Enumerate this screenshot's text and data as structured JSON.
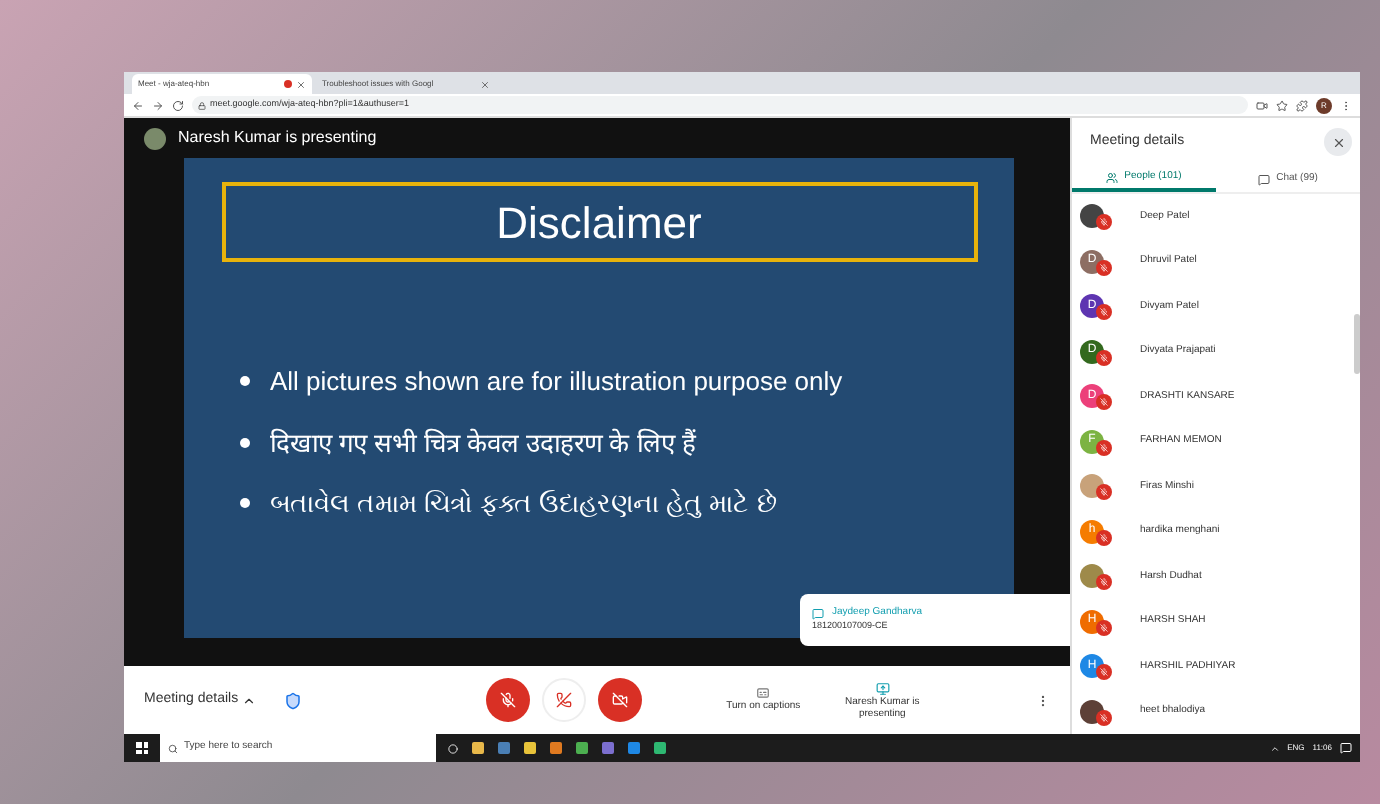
{
  "browser": {
    "tabs": [
      {
        "title": "Meet - wja-ateq-hbn",
        "selected": true,
        "recording": true
      },
      {
        "title": "Troubleshoot issues with Googl",
        "selected": false,
        "recording": false
      }
    ],
    "url": "meet.google.com/wja-ateq-hbn?pli=1&authuser=1",
    "profile_initial": "R"
  },
  "stage": {
    "presenter_label": "Naresh Kumar is presenting",
    "slide": {
      "title": "Disclaimer",
      "bullets": [
        "All pictures shown are for illustration purpose only",
        "दिखाए गए सभी चित्र केवल उदाहरण के लिए हैं",
        "બતાવેલ તમામ ચિત્રો ફક્ત ઉદાહરણના હેતુ માટે છે"
      ]
    },
    "toast": {
      "name": "Jaydeep Gandharva",
      "text": "181200107009-CE"
    }
  },
  "bottom_bar": {
    "meeting_details": "Meeting details",
    "mic_muted": true,
    "camera_off": true,
    "captions": "Turn on captions",
    "presenting": "Naresh Kumar is presenting"
  },
  "panel": {
    "title": "Meeting details",
    "tabs": [
      {
        "label": "People (101)",
        "selected": true
      },
      {
        "label": "Chat (99)",
        "selected": false
      }
    ],
    "participants": [
      {
        "name": "Deep Patel",
        "kind": "photo",
        "color": "#444444"
      },
      {
        "name": "Dhruvil Patel",
        "kind": "letter",
        "initial": "D",
        "color": "#8d6e63"
      },
      {
        "name": "Divyam Patel",
        "kind": "letter",
        "initial": "D",
        "color": "#5e35b1"
      },
      {
        "name": "Divyata Prajapati",
        "kind": "letter",
        "initial": "D",
        "color": "#33691e"
      },
      {
        "name": "DRASHTI KANSARE",
        "kind": "letter",
        "initial": "D",
        "color": "#ec407a"
      },
      {
        "name": "FARHAN MEMON",
        "kind": "letter",
        "initial": "F",
        "color": "#7cb342"
      },
      {
        "name": "Firas Minshi",
        "kind": "photo",
        "color": "#c8a27a"
      },
      {
        "name": "hardika menghani",
        "kind": "letter",
        "initial": "h",
        "color": "#f57c00"
      },
      {
        "name": "Harsh Dudhat",
        "kind": "photo",
        "color": "#9e8a4a"
      },
      {
        "name": "HARSH SHAH",
        "kind": "letter",
        "initial": "H",
        "color": "#ef6c00"
      },
      {
        "name": "HARSHIL PADHIYAR",
        "kind": "letter",
        "initial": "H",
        "color": "#1e88e5"
      },
      {
        "name": "heet bhalodiya",
        "kind": "photo",
        "color": "#5d4037"
      }
    ]
  },
  "taskbar": {
    "search_placeholder": "Type here to search",
    "time": "11:06",
    "language": "ENG"
  }
}
